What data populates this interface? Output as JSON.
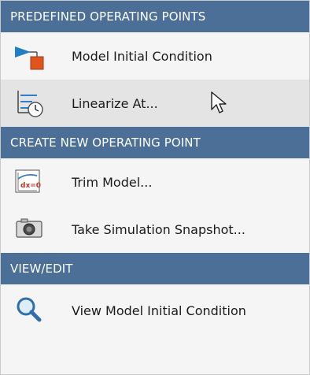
{
  "sections": [
    {
      "header": "PREDEFINED OPERATING POINTS",
      "items": [
        {
          "label": "Model Initial Condition",
          "icon": "model-initial-condition-icon"
        },
        {
          "label": "Linearize At...",
          "icon": "linearize-at-icon"
        }
      ]
    },
    {
      "header": "CREATE NEW OPERATING POINT",
      "items": [
        {
          "label": "Trim Model...",
          "icon": "trim-model-icon"
        },
        {
          "label": "Take Simulation Snapshot...",
          "icon": "camera-icon"
        }
      ]
    },
    {
      "header": "VIEW/EDIT",
      "items": [
        {
          "label": "View Model Initial Condition",
          "icon": "magnifier-icon"
        }
      ]
    }
  ],
  "trim_icon_text": "dx=0",
  "colors": {
    "header_bg": "#4b6f97",
    "hover_bg": "#e4e4e4",
    "menu_bg": "#f5f5f5"
  }
}
